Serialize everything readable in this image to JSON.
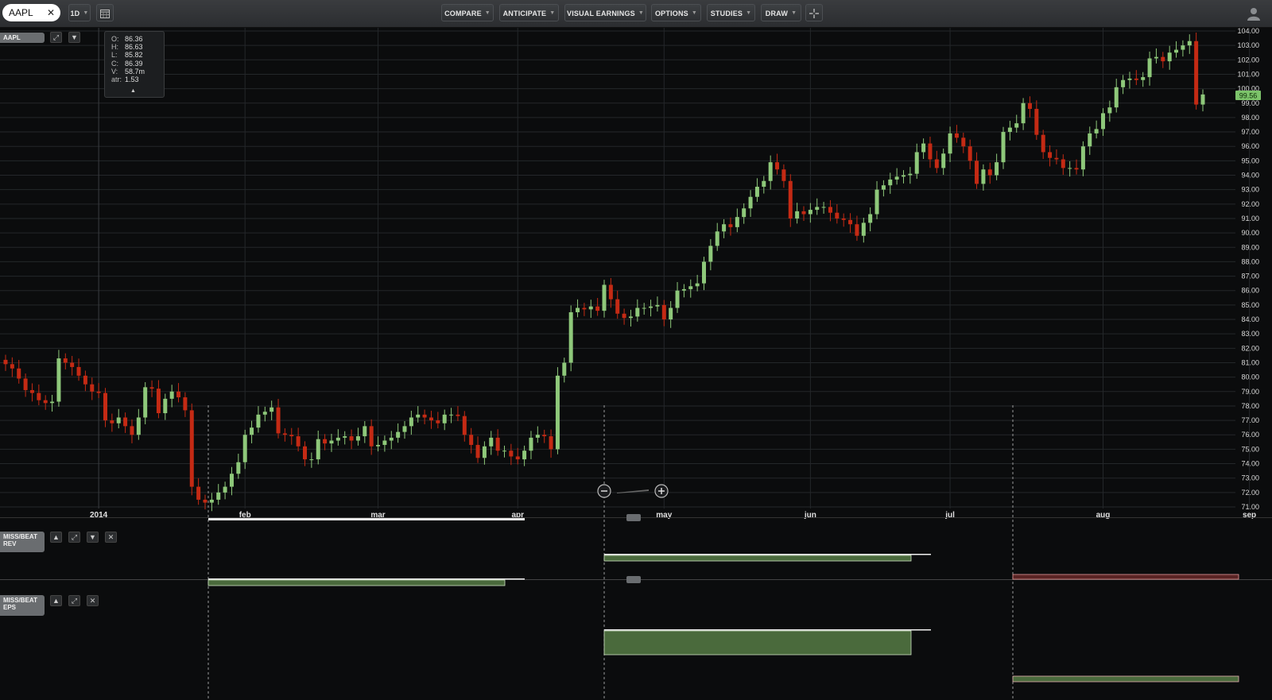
{
  "toolbar": {
    "symbol": "AAPL",
    "interval": "1D",
    "buttons": [
      "COMPARE",
      "ANTICIPATE",
      "VISUAL EARNINGS",
      "OPTIONS",
      "STUDIES",
      "DRAW"
    ]
  },
  "main_panel": {
    "label": "AAPL"
  },
  "panels": [
    {
      "label_line1": "MISS/BEAT",
      "label_line2": "REV"
    },
    {
      "label_line1": "MISS/BEAT",
      "label_line2": "EPS"
    }
  ],
  "ohlc": {
    "rows": [
      {
        "key": "O:",
        "value": "86.36"
      },
      {
        "key": "H:",
        "value": "86.63"
      },
      {
        "key": "L:",
        "value": "85.82"
      },
      {
        "key": "C:",
        "value": "86.39"
      },
      {
        "key": "V:",
        "value": "58.7m"
      },
      {
        "key": "atr:",
        "value": "1.53"
      }
    ]
  },
  "colors": {
    "up": "#8ec87a",
    "down": "#c42a14",
    "grid": "#24272a",
    "bg": "#0b0c0d",
    "price_tag": "#7cc36a",
    "beat": "#4a6a3c",
    "miss": "#c86464"
  },
  "icons": [
    "close-icon",
    "calendar-icon",
    "crosshair-icon",
    "user-icon",
    "expand-icon",
    "arrow-down-icon",
    "arrow-up-icon",
    "zoom-out-icon",
    "zoom-in-icon"
  ],
  "chart_data": {
    "type": "candlestick",
    "series_start": "2013-12-13",
    "x_tick_labels": [
      {
        "date": "2014-01-02",
        "label": "2014"
      },
      {
        "date": "2014-02-03",
        "label": "feb"
      },
      {
        "date": "2014-03-03",
        "label": "mar"
      },
      {
        "date": "2014-04-01",
        "label": "apr"
      },
      {
        "date": "2014-05-01",
        "label": "may"
      },
      {
        "date": "2014-06-02",
        "label": "jun"
      },
      {
        "date": "2014-07-01",
        "label": "jul"
      },
      {
        "date": "2014-08-01",
        "label": "aug"
      },
      {
        "date": "2014-09-02",
        "label": "sep"
      }
    ],
    "ylim": [
      71,
      104
    ],
    "y_ticks": [
      "71.00",
      "72.00",
      "73.00",
      "74.00",
      "75.00",
      "76.00",
      "77.00",
      "78.00",
      "79.00",
      "80.00",
      "81.00",
      "82.00",
      "83.00",
      "84.00",
      "85.00",
      "86.00",
      "87.00",
      "88.00",
      "89.00",
      "90.00",
      "91.00",
      "92.00",
      "93.00",
      "94.00",
      "95.00",
      "96.00",
      "97.00",
      "98.00",
      "99.00",
      "100.00",
      "101.00",
      "102.00",
      "103.00",
      "104.00"
    ],
    "last_price": "99.56",
    "close": [
      80.9,
      80.6,
      79.9,
      79.1,
      78.9,
      78.4,
      78.2,
      78.3,
      81.3,
      81.0,
      80.7,
      80.1,
      79.5,
      79.0,
      78.9,
      77.0,
      76.8,
      77.2,
      76.6,
      76.0,
      77.2,
      79.3,
      79.2,
      77.5,
      78.5,
      79.0,
      78.6,
      77.7,
      72.4,
      71.5,
      71.3,
      71.5,
      72.0,
      72.4,
      73.3,
      74.1,
      76.0,
      76.5,
      77.4,
      77.6,
      77.9,
      76.1,
      76.0,
      75.9,
      75.2,
      74.3,
      74.3,
      75.7,
      75.4,
      75.6,
      75.8,
      75.9,
      75.6,
      75.9,
      76.6,
      75.2,
      75.3,
      75.6,
      75.8,
      76.2,
      76.6,
      77.2,
      77.4,
      77.2,
      77.0,
      76.8,
      77.4,
      77.4,
      77.3,
      76.0,
      75.3,
      74.4,
      75.2,
      75.8,
      74.9,
      74.9,
      74.5,
      74.3,
      74.9,
      75.8,
      76.0,
      75.9,
      75.0,
      80.1,
      81.0,
      84.5,
      84.8,
      84.7,
      84.9,
      84.6,
      86.4,
      85.4,
      84.4,
      84.1,
      84.2,
      84.8,
      84.8,
      84.9,
      85.0,
      84.0,
      84.8,
      86.0,
      86.1,
      86.3,
      86.5,
      88.0,
      89.1,
      90.1,
      90.6,
      90.4,
      91.1,
      91.7,
      92.5,
      93.2,
      93.6,
      94.9,
      94.4,
      93.6,
      91.0,
      91.5,
      91.3,
      91.6,
      91.8,
      91.8,
      91.4,
      91.0,
      90.9,
      90.6,
      89.8,
      90.7,
      91.3,
      93.0,
      93.3,
      93.7,
      93.9,
      94.0,
      94.1,
      95.6,
      96.2,
      95.1,
      94.5,
      95.5,
      96.9,
      96.6,
      96.0,
      95.0,
      93.4,
      94.4,
      94.0,
      94.9,
      97.0,
      97.3,
      97.6,
      99.0,
      98.6,
      96.8,
      95.6,
      95.2,
      95.1,
      94.5,
      94.5,
      94.4,
      96.0,
      96.9,
      97.2,
      98.3,
      98.7,
      100.1,
      100.6,
      100.7,
      100.6,
      100.8,
      102.1,
      102.2,
      101.9,
      102.5,
      102.7,
      103.0,
      103.3,
      98.9,
      99.6
    ]
  }
}
